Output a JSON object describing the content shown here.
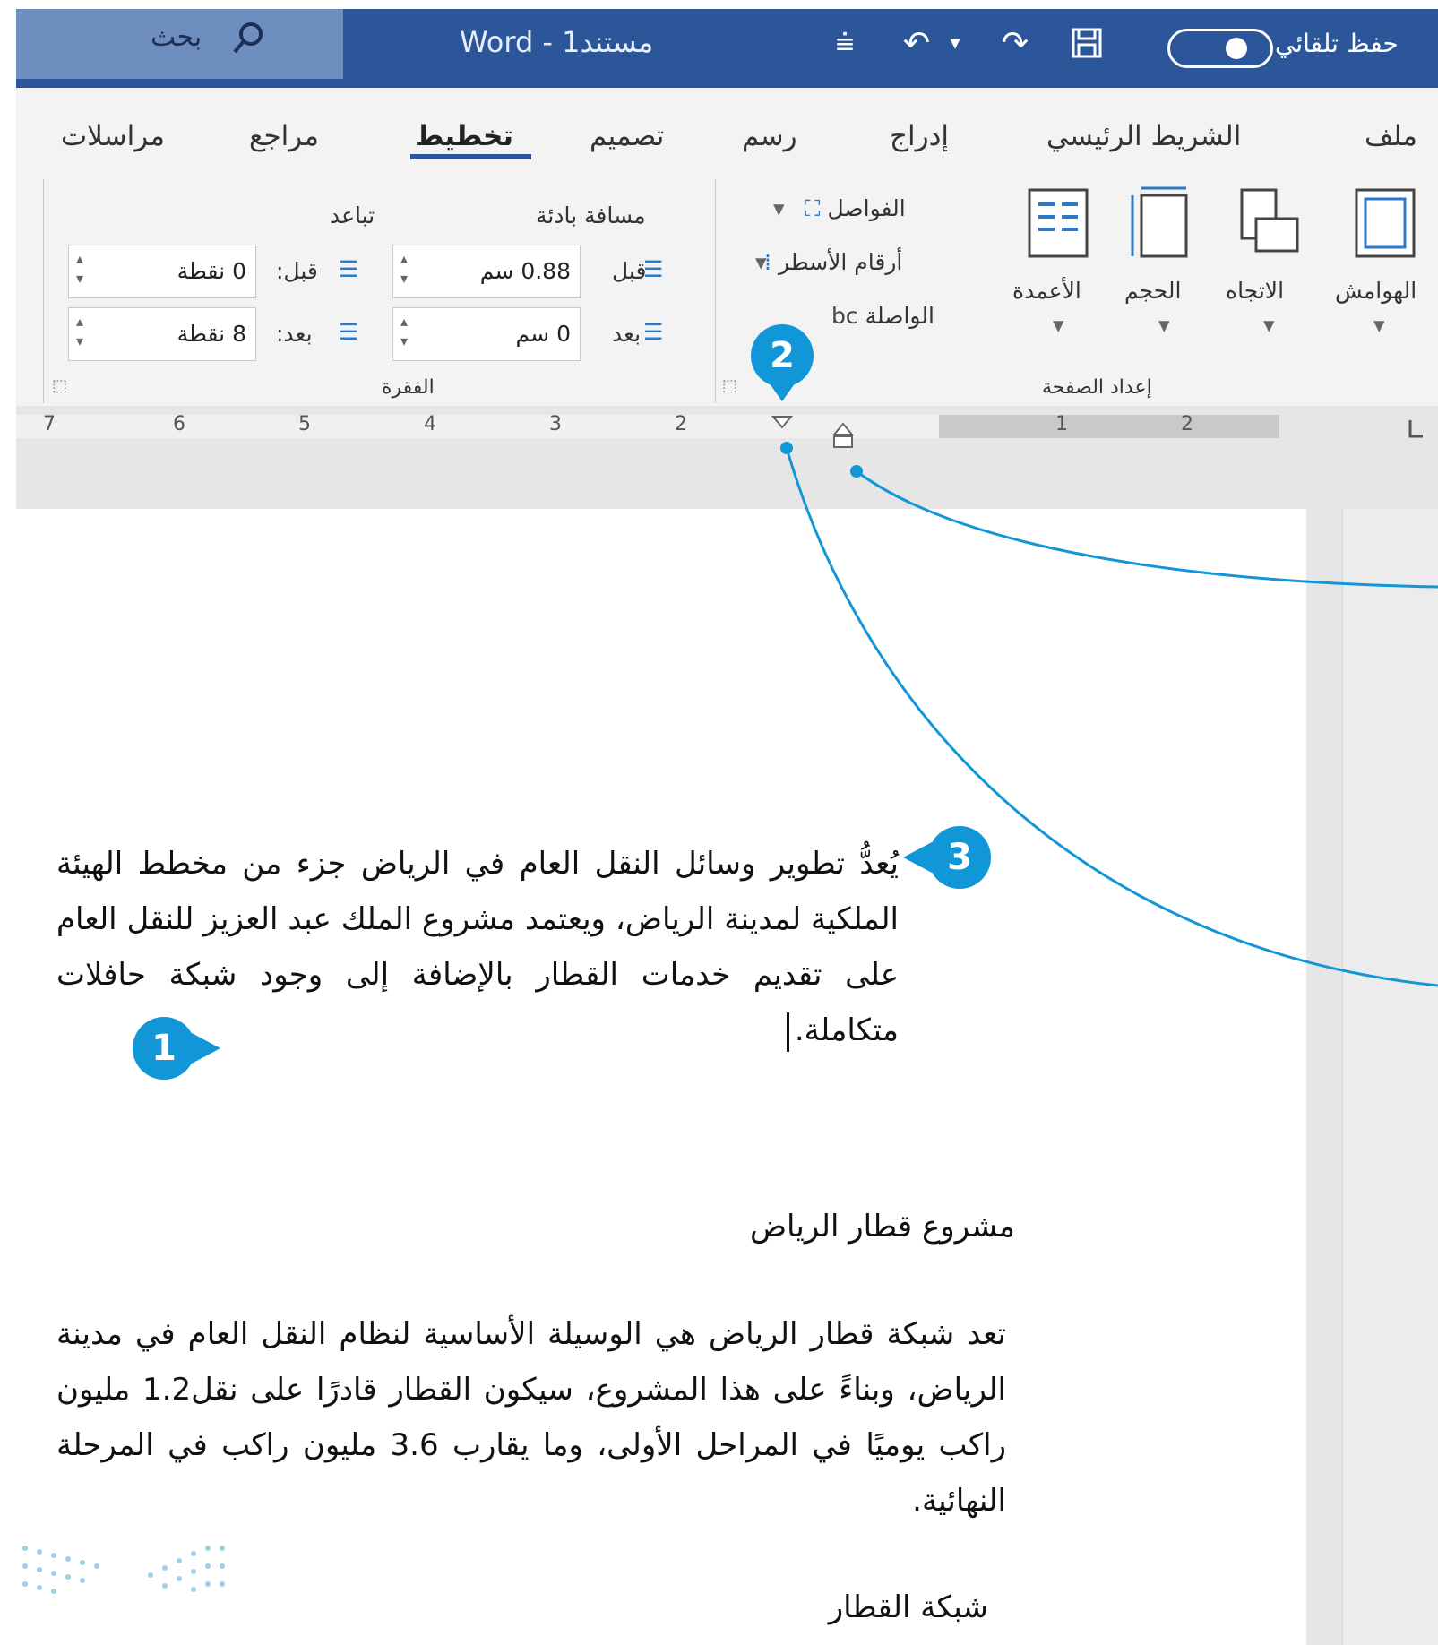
{
  "titlebar": {
    "search_label": "بحث",
    "document_title": "Word - مستند1",
    "autosave_label": "حفظ تلقائي"
  },
  "ribbon_tabs": [
    {
      "label": "ملف"
    },
    {
      "label": "الشريط الرئيسي"
    },
    {
      "label": "إدراج"
    },
    {
      "label": "رسم"
    },
    {
      "label": "تصميم"
    },
    {
      "label": "تخطيط",
      "active": true
    },
    {
      "label": "مراجع"
    },
    {
      "label": "مراسلات"
    }
  ],
  "page_setup": {
    "group_label": "إعداد الصفحة",
    "margins": "الهوامش",
    "orientation": "الاتجاه",
    "size": "الحجم",
    "columns": "الأعمدة",
    "breaks": "الفواصل",
    "line_numbers": "أرقام الأسطر",
    "hyphenation": "الواصلة"
  },
  "paragraph": {
    "group_label": "الفقرة",
    "indent_label": "مسافة بادئة",
    "spacing_label": "تباعد",
    "indent_before_label": "قبل",
    "indent_before_value": "0.88 سم",
    "indent_after_label": "بعد",
    "indent_after_value": "0 سم",
    "spacing_before_label": "قبل:",
    "spacing_before_value": "0 نقطة",
    "spacing_after_label": "بعد:",
    "spacing_after_value": "8 نقطة"
  },
  "ruler": {
    "numbers": [
      "7",
      "6",
      "5",
      "4",
      "3",
      "2",
      "1",
      "2"
    ]
  },
  "callouts": [
    "1",
    "2",
    "3"
  ],
  "document": {
    "paragraph1": "يُعدُّ تطوير وسائل النقل العام في الرياض جزء من مخطط الهيئة الملكية لمدينة الرياض، ويعتمد مشروع الملك عبد العزيز للنقل العام على تقديم خدمات القطار بالإضافة إلى وجود شبكة حافلات متكاملة.",
    "heading1": "مشروع قطار الرياض",
    "paragraph2": "تعد شبكة قطار الرياض هي الوسيلة الأساسية لنظام النقل العام في مدينة الرياض، وبناءً على هذا المشروع، سيكون القطار قادرًا على نقل1.2 مليون راكب يوميًا في المراحل الأولى، وما يقارب 3.6 مليون راكب في المرحلة النهائية.",
    "heading2": "شبكة القطار"
  },
  "colors": {
    "titlebar": "#2b579a",
    "callout": "#1196d8"
  }
}
